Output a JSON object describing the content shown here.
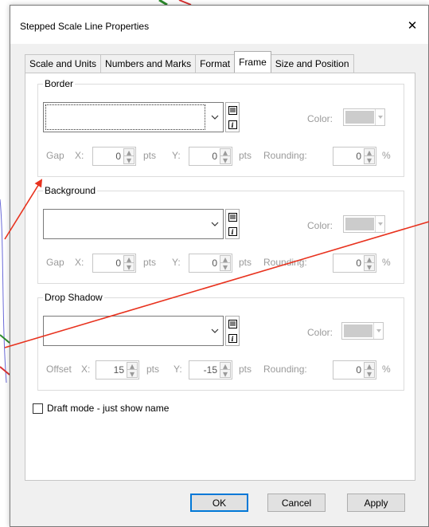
{
  "dialog": {
    "title": "Stepped Scale Line Properties",
    "close_glyph": "✕"
  },
  "tabs": [
    {
      "label": "Scale and Units",
      "active": false
    },
    {
      "label": "Numbers and Marks",
      "active": false
    },
    {
      "label": "Format",
      "active": false
    },
    {
      "label": "Frame",
      "active": true
    },
    {
      "label": "Size and Position",
      "active": false
    }
  ],
  "border": {
    "legend": "Border",
    "color_label": "Color:",
    "gap_label": "Gap",
    "x_label": "X:",
    "x_value": "0",
    "x_unit": "pts",
    "y_label": "Y:",
    "y_value": "0",
    "y_unit": "pts",
    "rounding_label": "Rounding:",
    "rounding_value": "0",
    "rounding_unit": "%"
  },
  "background": {
    "legend": "Background",
    "color_label": "Color:",
    "gap_label": "Gap",
    "x_label": "X:",
    "x_value": "0",
    "x_unit": "pts",
    "y_label": "Y:",
    "y_value": "0",
    "y_unit": "pts",
    "rounding_label": "Rounding:",
    "rounding_value": "0",
    "rounding_unit": "%"
  },
  "shadow": {
    "legend": "Drop Shadow",
    "color_label": "Color:",
    "offset_label": "Offset",
    "x_label": "X:",
    "x_value": "15",
    "x_unit": "pts",
    "y_label": "Y:",
    "y_value": "-15",
    "y_unit": "pts",
    "rounding_label": "Rounding:",
    "rounding_value": "0",
    "rounding_unit": "%"
  },
  "draft_mode": {
    "label": "Draft mode - just show name",
    "checked": false
  },
  "buttons": {
    "ok": "OK",
    "cancel": "Cancel",
    "apply": "Apply"
  },
  "colors": {
    "annotation_arrow": "#e8321e",
    "default_button_border": "#0078d7"
  }
}
